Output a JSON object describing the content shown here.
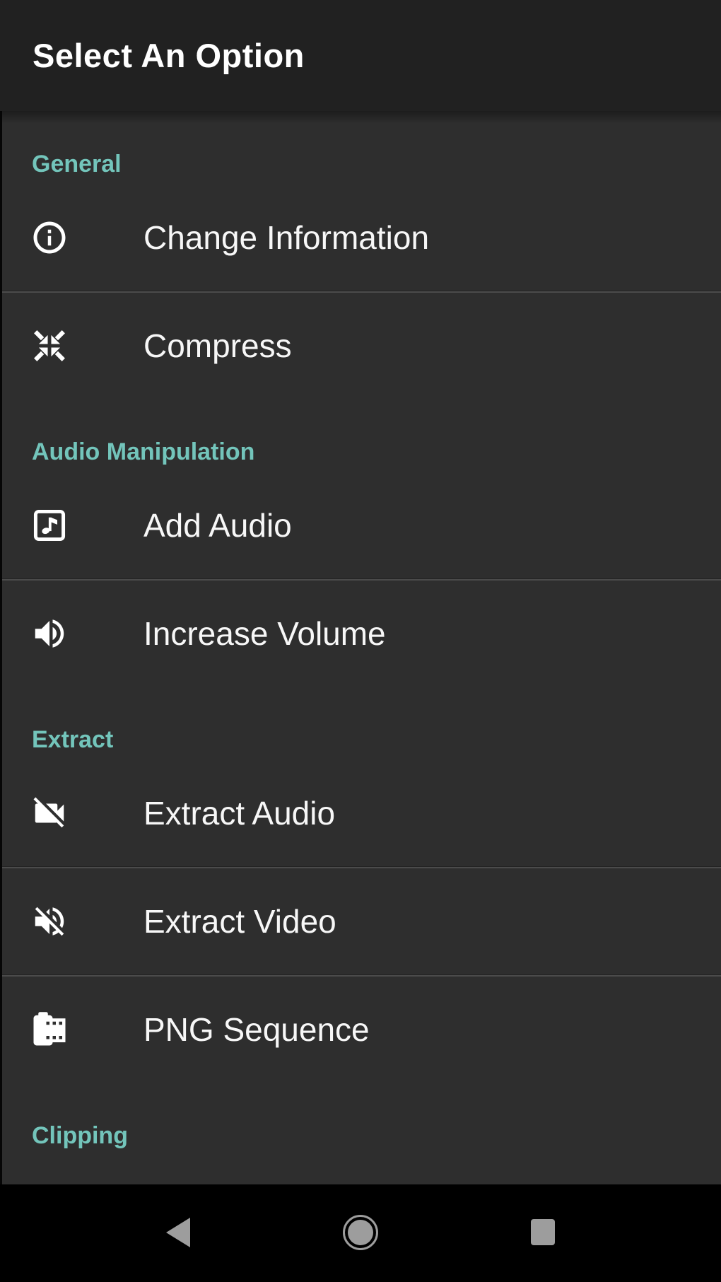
{
  "title_bar": {
    "title": "Select An Option"
  },
  "theme": {
    "accent": "#73c5bb",
    "title_bar_bg": "#212121",
    "body_bg": "#2e2e2e",
    "nav_bg": "#000000",
    "nav_icon": "#9d9d9d",
    "item_text": "#f7f7f7",
    "title_text": "#ffffff",
    "divider_light": "#4b4b4b",
    "divider_dark": "#232323"
  },
  "sections": [
    {
      "label": "General",
      "items": [
        {
          "label": "Change Information",
          "icon": "info-icon"
        },
        {
          "label": "Compress",
          "icon": "compress-icon"
        }
      ]
    },
    {
      "label": "Audio Manipulation",
      "items": [
        {
          "label": "Add Audio",
          "icon": "music-note-box-icon"
        },
        {
          "label": "Increase Volume",
          "icon": "volume-up-icon"
        }
      ]
    },
    {
      "label": "Extract",
      "items": [
        {
          "label": "Extract Audio",
          "icon": "videocam-off-icon"
        },
        {
          "label": "Extract Video",
          "icon": "volume-off-icon"
        },
        {
          "label": "PNG Sequence",
          "icon": "camera-roll-icon"
        }
      ]
    },
    {
      "label": "Clipping",
      "items": []
    }
  ],
  "nav_bar": {
    "buttons": [
      {
        "name": "back-button",
        "icon": "back-icon"
      },
      {
        "name": "home-button",
        "icon": "home-icon"
      },
      {
        "name": "recents-button",
        "icon": "recents-icon"
      }
    ]
  }
}
